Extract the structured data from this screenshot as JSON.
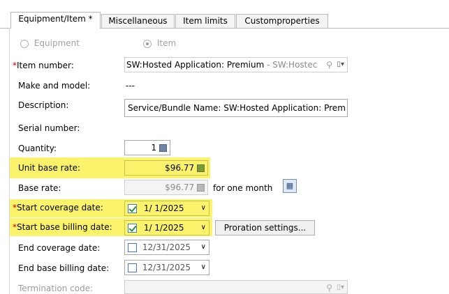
{
  "tabs": [
    {
      "label": "Equipment/Item *"
    },
    {
      "label": "Miscellaneous"
    },
    {
      "label": "Item limits"
    },
    {
      "label": "Customproperties"
    }
  ],
  "type_options": {
    "equipment": "Equipment",
    "item": "Item"
  },
  "labels": {
    "item_number": "Item number:",
    "make_model": "Make and model:",
    "description": "Description:",
    "serial_number": "Serial number:",
    "quantity": "Quantity:",
    "unit_base_rate": "Unit base rate:",
    "base_rate": "Base rate:",
    "start_coverage": "Start coverage date:",
    "start_billing": "Start base billing date:",
    "end_coverage": "End coverage date:",
    "end_billing": "End base billing date:",
    "termination_code": "Termination code:"
  },
  "required_mark": "*",
  "values": {
    "item_number_main": "SW:Hosted Application: Premium",
    "item_number_suffix": " - SW:Hostec",
    "make_model": "---",
    "description": "Service/Bundle Name: SW:Hosted Application: Prem",
    "quantity": "1",
    "unit_base_rate": "$96.77",
    "base_rate": "$96.77",
    "base_rate_period": "for one month",
    "start_coverage": "1/ 1/2025",
    "start_billing": "1/ 1/2025",
    "end_coverage": "12/31/2025",
    "end_billing": "12/31/2025"
  },
  "proration_button": "Proration settings...",
  "colors": {
    "highlight": "#fbf36b",
    "required": "#c00000"
  }
}
